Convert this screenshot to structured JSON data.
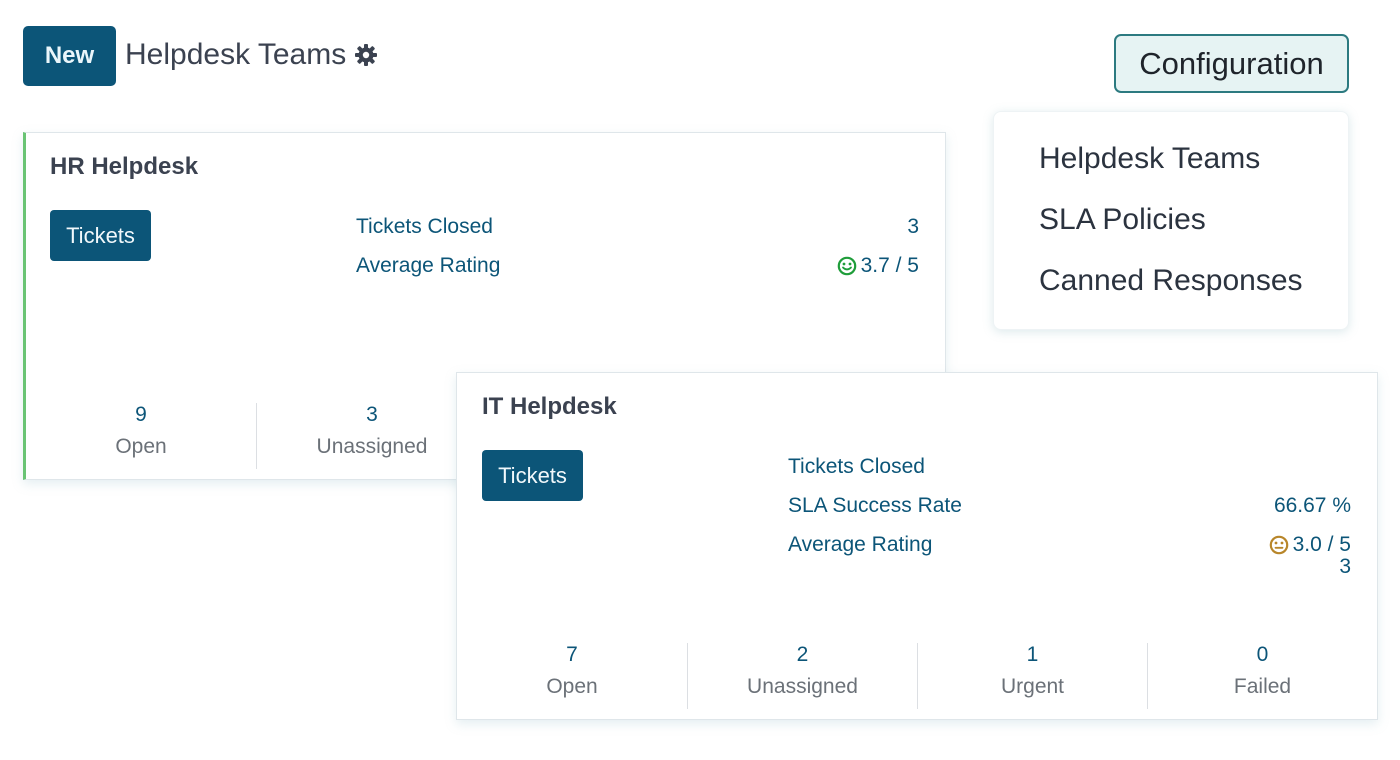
{
  "header": {
    "new_label": "New",
    "title": "Helpdesk Teams",
    "config_label": "Configuration"
  },
  "config_menu": {
    "items": [
      "Helpdesk Teams",
      "SLA Policies",
      "Canned Responses"
    ]
  },
  "teams": [
    {
      "name": "HR Helpdesk",
      "accent_color": "#6ac474",
      "tickets_label": "Tickets",
      "stats": [
        {
          "label": "Tickets Closed",
          "value": "3"
        },
        {
          "label": "Average Rating",
          "value": "3.7 / 5",
          "icon": "smile-icon",
          "icon_color": "#1f9d3a"
        }
      ],
      "kpis": [
        {
          "value": "9",
          "label": "Open"
        },
        {
          "value": "3",
          "label": "Unassigned"
        }
      ]
    },
    {
      "name": "IT Helpdesk",
      "tickets_label": "Tickets",
      "stats": [
        {
          "label": "Tickets Closed",
          "value": "3"
        },
        {
          "label": "SLA Success Rate",
          "value": "66.67 %"
        },
        {
          "label": "Average Rating",
          "value": "3.0 / 5",
          "icon": "neutral-face-icon",
          "icon_color": "#b8862a"
        }
      ],
      "kpis": [
        {
          "value": "7",
          "label": "Open"
        },
        {
          "value": "2",
          "label": "Unassigned"
        },
        {
          "value": "1",
          "label": "Urgent"
        },
        {
          "value": "0",
          "label": "Failed"
        }
      ]
    }
  ],
  "colors": {
    "primary": "#0c5578",
    "config_border": "#2c7a80",
    "config_bg": "#e6f3f3"
  }
}
